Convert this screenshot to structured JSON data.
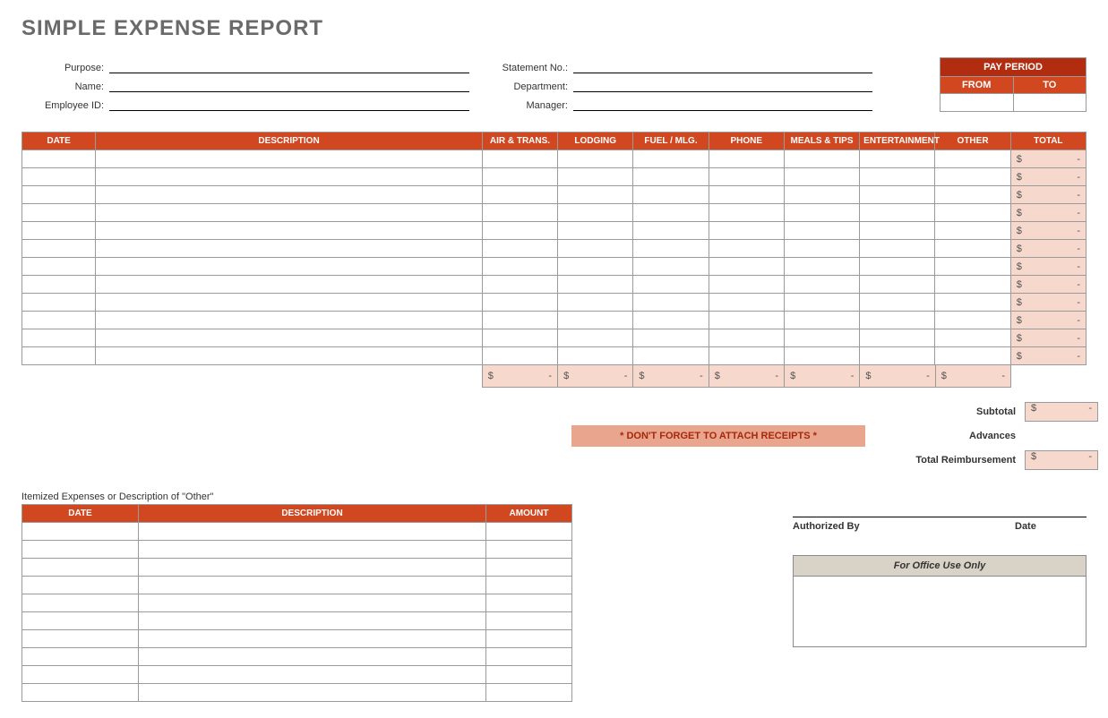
{
  "title": "SIMPLE EXPENSE REPORT",
  "meta": {
    "left": [
      {
        "label": "Purpose:",
        "value": ""
      },
      {
        "label": "Name:",
        "value": ""
      },
      {
        "label": "Employee ID:",
        "value": ""
      }
    ],
    "right": [
      {
        "label": "Statement No.:",
        "value": ""
      },
      {
        "label": "Department:",
        "value": ""
      },
      {
        "label": "Manager:",
        "value": ""
      }
    ]
  },
  "pay_period": {
    "heading": "PAY PERIOD",
    "from_label": "FROM",
    "to_label": "TO",
    "from": "",
    "to": ""
  },
  "columns": {
    "date": "DATE",
    "description": "DESCRIPTION",
    "air": "AIR & TRANS.",
    "lodging": "LODGING",
    "fuel": "FUEL / MLG.",
    "phone": "PHONE",
    "meals": "MEALS & TIPS",
    "ent": "ENTERTAINMENT",
    "other": "OTHER",
    "total": "TOTAL"
  },
  "rows": 12,
  "money_placeholder": {
    "symbol": "$",
    "dash": "-"
  },
  "summary": {
    "subtotal": "Subtotal",
    "advances": "Advances",
    "total_reimb": "Total Reimbursement"
  },
  "banner": "*  DON'T FORGET TO ATTACH RECEIPTS  *",
  "detail": {
    "caption": "Itemized Expenses or Description of \"Other\"",
    "cols": {
      "date": "DATE",
      "description": "DESCRIPTION",
      "amount": "AMOUNT"
    },
    "rows": 10
  },
  "authorize": {
    "by": "Authorized By",
    "date": "Date"
  },
  "office": {
    "heading": "For Office Use Only"
  }
}
